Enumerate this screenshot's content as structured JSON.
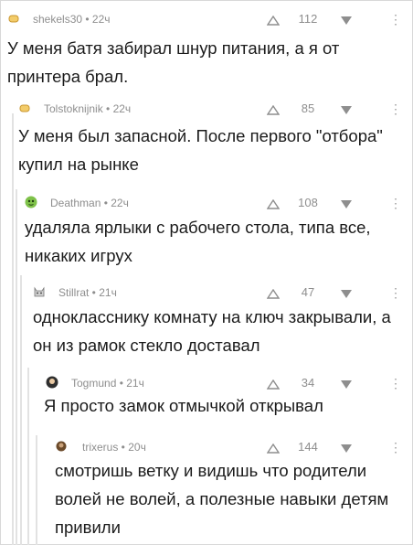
{
  "comments": [
    {
      "user": "shekels30",
      "time": "22ч",
      "score": "112",
      "avatar": "loaf-icon",
      "text": "У меня батя забирал шнур питания, а я от принтера брал."
    },
    {
      "user": "Tolstoknijnik",
      "time": "22ч",
      "score": "85",
      "avatar": "loaf-icon",
      "text": "У меня был запасной. После первого \"отбора\" купил на рынке"
    },
    {
      "user": "Deathman",
      "time": "22ч",
      "score": "108",
      "avatar": "green-face-icon",
      "text": "удаляла ярлыки с рабочего стола, типа все, никаких игрух"
    },
    {
      "user": "Stillrat",
      "time": "21ч",
      "score": "47",
      "avatar": "cat-icon",
      "text": "однокласснику комнату на ключ закрывали, а он из рамок стекло доставал"
    },
    {
      "user": "Togmund",
      "time": "21ч",
      "score": "34",
      "avatar": "dark-face-icon",
      "text": "Я просто замок отмычкой открывал"
    },
    {
      "user": "trixerus",
      "time": "20ч",
      "score": "144",
      "avatar": "brown-dot-icon",
      "text": "смотришь ветку и видишь что родители волей не волей, а полезные навыки детям привили"
    }
  ],
  "separator": " • ",
  "colors": {
    "meta": "#8e8e8e",
    "thread_line": "#e2e2e2",
    "text": "#1b1b1b"
  }
}
